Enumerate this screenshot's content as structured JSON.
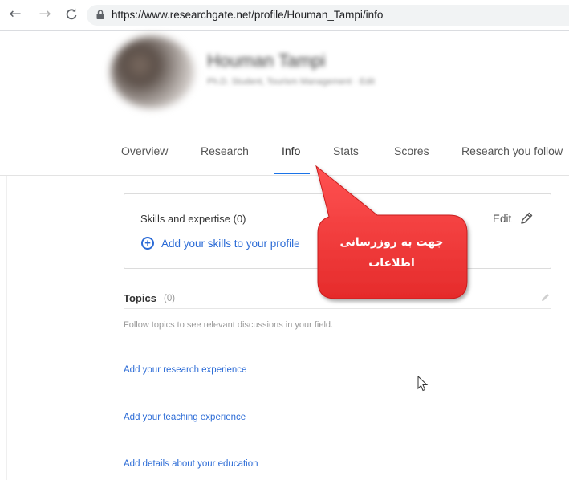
{
  "browser": {
    "back_glyph": "←",
    "forward_glyph": "→",
    "reload_glyph": "C",
    "url": "https://www.researchgate.net/profile/Houman_Tampi/info"
  },
  "profile": {
    "name": "Houman Tampi",
    "subtitle": "Ph.D. Student, Tourism Management · Edit"
  },
  "tabs": [
    {
      "label": "Overview"
    },
    {
      "label": "Research"
    },
    {
      "label": "Info"
    },
    {
      "label": "Stats"
    },
    {
      "label": "Scores"
    },
    {
      "label": "Research you follow"
    }
  ],
  "skills": {
    "title": "Skills and expertise (0)",
    "add_label": "Add your skills to your profile",
    "edit_label": "Edit"
  },
  "topics": {
    "title": "Topics",
    "count": "(0)",
    "hint": "Follow topics to see relevant discussions in your field."
  },
  "links": {
    "research_experience": "Add your research experience",
    "teaching_experience": "Add your teaching experience",
    "education": "Add details about your education"
  },
  "callout": {
    "line1": "جهت به روزرسانی",
    "line2": "اطلاعات"
  },
  "colors": {
    "accent_blue": "#2b6bd6",
    "tab_underline": "#1a73e8",
    "callout_red": "#f53b3b"
  }
}
